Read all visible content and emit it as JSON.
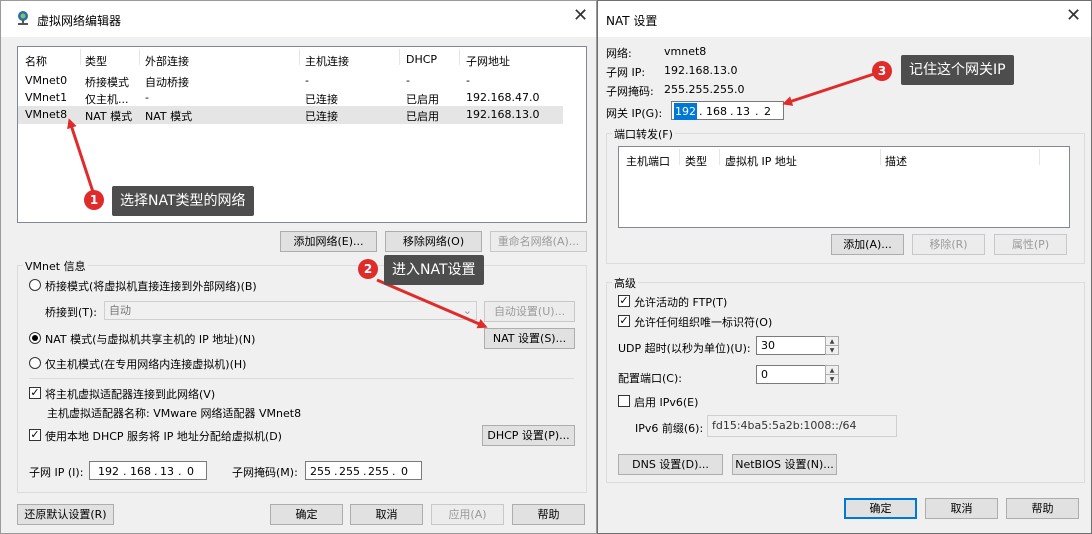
{
  "left_window": {
    "title": "虚拟网络编辑器",
    "table": {
      "headers": [
        "名称",
        "类型",
        "外部连接",
        "主机连接",
        "DHCP",
        "子网地址"
      ],
      "rows": [
        [
          "VMnet0",
          "桥接模式",
          "自动桥接",
          "-",
          "-",
          "-"
        ],
        [
          "VMnet1",
          "仅主机...",
          "-",
          "已连接",
          "已启用",
          "192.168.47.0"
        ],
        [
          "VMnet8",
          "NAT 模式",
          "NAT 模式",
          "已连接",
          "已启用",
          "192.168.13.0"
        ]
      ]
    },
    "buttons": {
      "add_network": "添加网络(E)...",
      "remove_network": "移除网络(O)",
      "rename_network": "重命名网络(A)..."
    },
    "vmnet_info": {
      "title": "VMnet 信息",
      "bridge_mode": "桥接模式(将虚拟机直接连接到外部网络)(B)",
      "bridge_to_label": "桥接到(T):",
      "bridge_to_value": "自动",
      "auto_settings": "自动设置(U)...",
      "nat_mode": "NAT 模式(与虚拟机共享主机的 IP 地址)(N)",
      "nat_settings": "NAT 设置(S)...",
      "host_only_mode": "仅主机模式(在专用网络内连接虚拟机)(H)",
      "connect_adapter": "将主机虚拟适配器连接到此网络(V)",
      "adapter_name": "主机虚拟适配器名称: VMware 网络适配器 VMnet8",
      "use_dhcp": "使用本地 DHCP 服务将 IP 地址分配给虚拟机(D)",
      "dhcp_settings": "DHCP 设置(P)...",
      "subnet_ip_label": "子网 IP (I):",
      "subnet_ip": [
        "192",
        "168",
        "13",
        "0"
      ],
      "subnet_mask_label": "子网掩码(M):",
      "subnet_mask": [
        "255",
        "255",
        "255",
        "0"
      ]
    },
    "bottom_buttons": {
      "restore": "还原默认设置(R)",
      "ok": "确定",
      "cancel": "取消",
      "apply": "应用(A)",
      "help": "帮助"
    }
  },
  "right_window": {
    "title": "NAT 设置",
    "network_label": "网络:",
    "network_value": "vmnet8",
    "subnet_ip_label": "子网 IP:",
    "subnet_ip_value": "192.168.13.0",
    "subnet_mask_label": "子网掩码:",
    "subnet_mask_value": "255.255.255.0",
    "gateway_label": "网关 IP(G):",
    "gateway_ip": [
      "192",
      "168",
      "13",
      "2"
    ],
    "port_forwarding": {
      "title": "端口转发(F)",
      "headers": [
        "主机端口",
        "类型",
        "虚拟机 IP 地址",
        "描述"
      ],
      "add": "添加(A)...",
      "remove": "移除(R)",
      "properties": "属性(P)"
    },
    "advanced": {
      "title": "高级",
      "allow_ftp": "允许活动的 FTP(T)",
      "allow_oui": "允许任何组织唯一标识符(O)",
      "udp_timeout_label": "UDP 超时(以秒为单位)(U):",
      "udp_timeout_value": "30",
      "config_port_label": "配置端口(C):",
      "config_port_value": "0",
      "enable_ipv6": "启用 IPv6(E)",
      "ipv6_prefix_label": "IPv6 前缀(6):",
      "ipv6_prefix_value": "fd15:4ba5:5a2b:1008::/64"
    },
    "dns_settings": "DNS 设置(D)...",
    "netbios_settings": "NetBIOS 设置(N)...",
    "ok": "确定",
    "cancel": "取消",
    "help": "帮助"
  },
  "annotations": {
    "step1_num": "1",
    "step1_text": "选择NAT类型的网络",
    "step2_num": "2",
    "step2_text": "进入NAT设置",
    "step3_num": "3",
    "step3_text": "记住这个网关IP",
    "color": "#e02b2b"
  },
  "colors": {
    "window_bg": "#f0f0f0",
    "selection": "#0078d7",
    "callout_bg": "#4d4d4d"
  }
}
